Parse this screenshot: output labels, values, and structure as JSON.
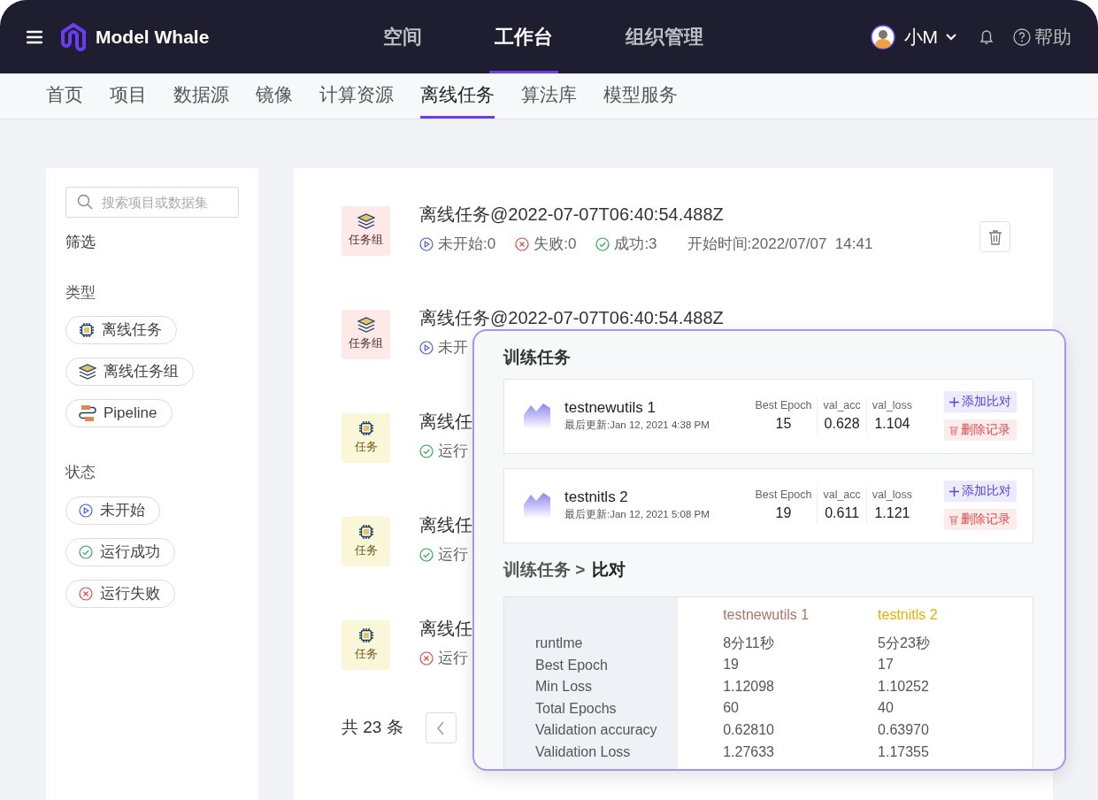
{
  "top_nav": {
    "brand": "Model Whale",
    "items": [
      {
        "label": "空间",
        "selected": false
      },
      {
        "label": "工作台",
        "selected": true
      },
      {
        "label": "组织管理",
        "selected": false
      }
    ],
    "user": "小M",
    "help": "帮助"
  },
  "sub_nav": [
    {
      "label": "首页",
      "selected": false
    },
    {
      "label": "项目",
      "selected": false
    },
    {
      "label": "数据源",
      "selected": false
    },
    {
      "label": "镜像",
      "selected": false
    },
    {
      "label": "计算资源",
      "selected": false
    },
    {
      "label": "离线任务",
      "selected": true
    },
    {
      "label": "算法库",
      "selected": false
    },
    {
      "label": "模型服务",
      "selected": false
    }
  ],
  "sidebar": {
    "search_placeholder": "搜索项目或数据集",
    "filter_title": "筛选",
    "groups": [
      {
        "title": "类型",
        "chips": [
          {
            "label": "离线任务",
            "kind": "task"
          },
          {
            "label": "离线任务组",
            "kind": "group"
          },
          {
            "label": "Pipeline",
            "kind": "pipeline"
          }
        ]
      },
      {
        "title": "状态",
        "chips": [
          {
            "label": "未开始",
            "kind": "pending"
          },
          {
            "label": "运行成功",
            "kind": "success"
          },
          {
            "label": "运行失败",
            "kind": "failed"
          }
        ]
      }
    ]
  },
  "tasks": [
    {
      "kind": "group",
      "badge": "任务组",
      "title": "离线任务@2022-07-07T06:40:54.488Z",
      "statuses": [
        {
          "kind": "pending",
          "text": "未开始:0"
        },
        {
          "kind": "failed",
          "text": "失败:0"
        },
        {
          "kind": "success",
          "text": "成功:3"
        }
      ],
      "start_time": "开始时间:2022/07/07  14:41",
      "hovered": true
    },
    {
      "kind": "group",
      "badge": "任务组",
      "title": "离线任务@2022-07-07T06:40:54.488Z",
      "statuses": [
        {
          "kind": "pending",
          "text": "未开"
        }
      ],
      "hovered": false
    },
    {
      "kind": "task",
      "badge": "任务",
      "title": "离线任",
      "statuses": [
        {
          "kind": "success",
          "text": "运行"
        }
      ]
    },
    {
      "kind": "task",
      "badge": "任务",
      "title": "离线任",
      "statuses": [
        {
          "kind": "success",
          "text": "运行"
        }
      ]
    },
    {
      "kind": "task",
      "badge": "任务",
      "title": "离线任",
      "statuses": [
        {
          "kind": "failed",
          "text": "运行"
        }
      ]
    }
  ],
  "pagination": {
    "total": "共 23 条"
  },
  "training_panel": {
    "title": "训练任务",
    "runs": [
      {
        "name": "testnewutils 1",
        "updated": "最后更新:Jan 12, 2021 4:38 PM",
        "metrics": [
          {
            "label": "Best Epoch",
            "value": "15"
          },
          {
            "label": "val_acc",
            "value": "0.628"
          },
          {
            "label": "val_loss",
            "value": "1.104"
          }
        ],
        "add": "添加比对",
        "delete": "删除记录"
      },
      {
        "name": "testnitls 2",
        "updated": "最后更新:Jan 12, 2021 5:08 PM",
        "metrics": [
          {
            "label": "Best Epoch",
            "value": "19"
          },
          {
            "label": "val_acc",
            "value": "0.611"
          },
          {
            "label": "val_loss",
            "value": "1.121"
          }
        ],
        "add": "添加比对",
        "delete": "删除记录"
      }
    ],
    "compare": {
      "crumb": "训练任务 >",
      "current": "比对",
      "columns": [
        {
          "name": "testnewutils 1",
          "color": "#a9766c"
        },
        {
          "name": "testnitls 2",
          "color": "#e5b300"
        }
      ],
      "rows": [
        {
          "label": "runtlme",
          "values": [
            "8分11秒",
            "5分23秒"
          ]
        },
        {
          "label": "Best Epoch",
          "values": [
            "19",
            "17"
          ]
        },
        {
          "label": "Min Loss",
          "values": [
            "1.12098",
            "1.10252"
          ]
        },
        {
          "label": "Total Epochs",
          "values": [
            "60",
            "40"
          ]
        },
        {
          "label": "Validation accuracy",
          "values": [
            "0.62810",
            "0.63970"
          ]
        },
        {
          "label": "Validation Loss",
          "values": [
            "1.27633",
            "1.17355"
          ]
        }
      ]
    }
  }
}
